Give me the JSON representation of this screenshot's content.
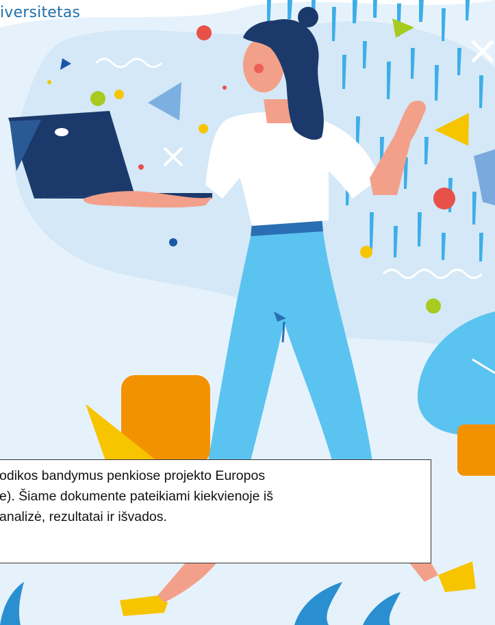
{
  "header": {
    "brand_text": "iversitetas"
  },
  "description": {
    "lines": [
      "odikos bandymus penkiose projekto Europos",
      "e). Šiame dokumente pateikiami kiekvienoje iš",
      "analizė, rezultatai ir išvados."
    ]
  },
  "colors": {
    "brand_blue": "#1f6fa8",
    "navy": "#1b3a6b",
    "light_blue": "#5bc3f0",
    "pale_blue": "#dcecf8",
    "orange": "#f39200",
    "yellow": "#f7c400",
    "red": "#e8504a",
    "green": "#a7cb1f",
    "skin": "#f3a08a"
  }
}
